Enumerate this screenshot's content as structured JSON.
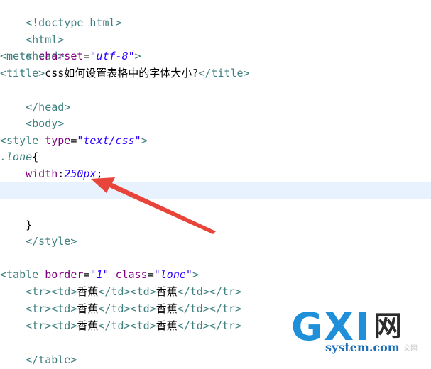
{
  "code": {
    "doctype": "<!doctype html>",
    "html_open": "<html>",
    "head_open": "<head>",
    "meta": {
      "open": "<meta ",
      "attr": "charset",
      "eq": "=",
      "value": "\"utf-8\"",
      "close": ">"
    },
    "title": {
      "open": "<title>",
      "text": "css如何设置表格中的字体大小?",
      "close": "</title>"
    },
    "head_close": "</head>",
    "body_open": "<body>",
    "style": {
      "open": "<style ",
      "attr": "type",
      "eq": "=",
      "value": "\"text/css\"",
      "close": ">"
    },
    "selector": ".lone",
    "brace_open": "{",
    "prop": "width",
    "colon": ":",
    "prop_value": "250px",
    "semicolon": ";",
    "brace_close": "}",
    "style_close": "</style>",
    "table": {
      "open": "<table ",
      "attr1": "border",
      "val1": "\"1\"",
      "attr2": "class",
      "val2": "\"lone\"",
      "close": ">"
    },
    "rows": [
      {
        "indent": "    ",
        "tr_open": "<tr><td>",
        "c1": "香蕉",
        "mid": "</td><td>",
        "c2": "香蕉",
        "end": "</td></tr>"
      },
      {
        "indent": "    ",
        "tr_open": "<tr><td>",
        "c1": "香蕉",
        "mid": "</td><td>",
        "c2": "香蕉",
        "end": "</td></tr>"
      },
      {
        "indent": "    ",
        "tr_open": "<tr><td>",
        "c1": "香蕉",
        "mid": "</td><td>",
        "c2": "香蕉",
        "end": "</td></tr>"
      }
    ],
    "table_close": "</table>"
  },
  "watermark": {
    "logo_text": "GXI",
    "logo_char": "网",
    "domain": "system.com",
    "side_text": "文网"
  },
  "colors": {
    "tag": "#3f7f7f",
    "attribute": "#7f007f",
    "value": "#2a00ff",
    "current_line": "#e8f2fe",
    "arrow": "#e8443a",
    "watermark": "#1e8fd8"
  }
}
